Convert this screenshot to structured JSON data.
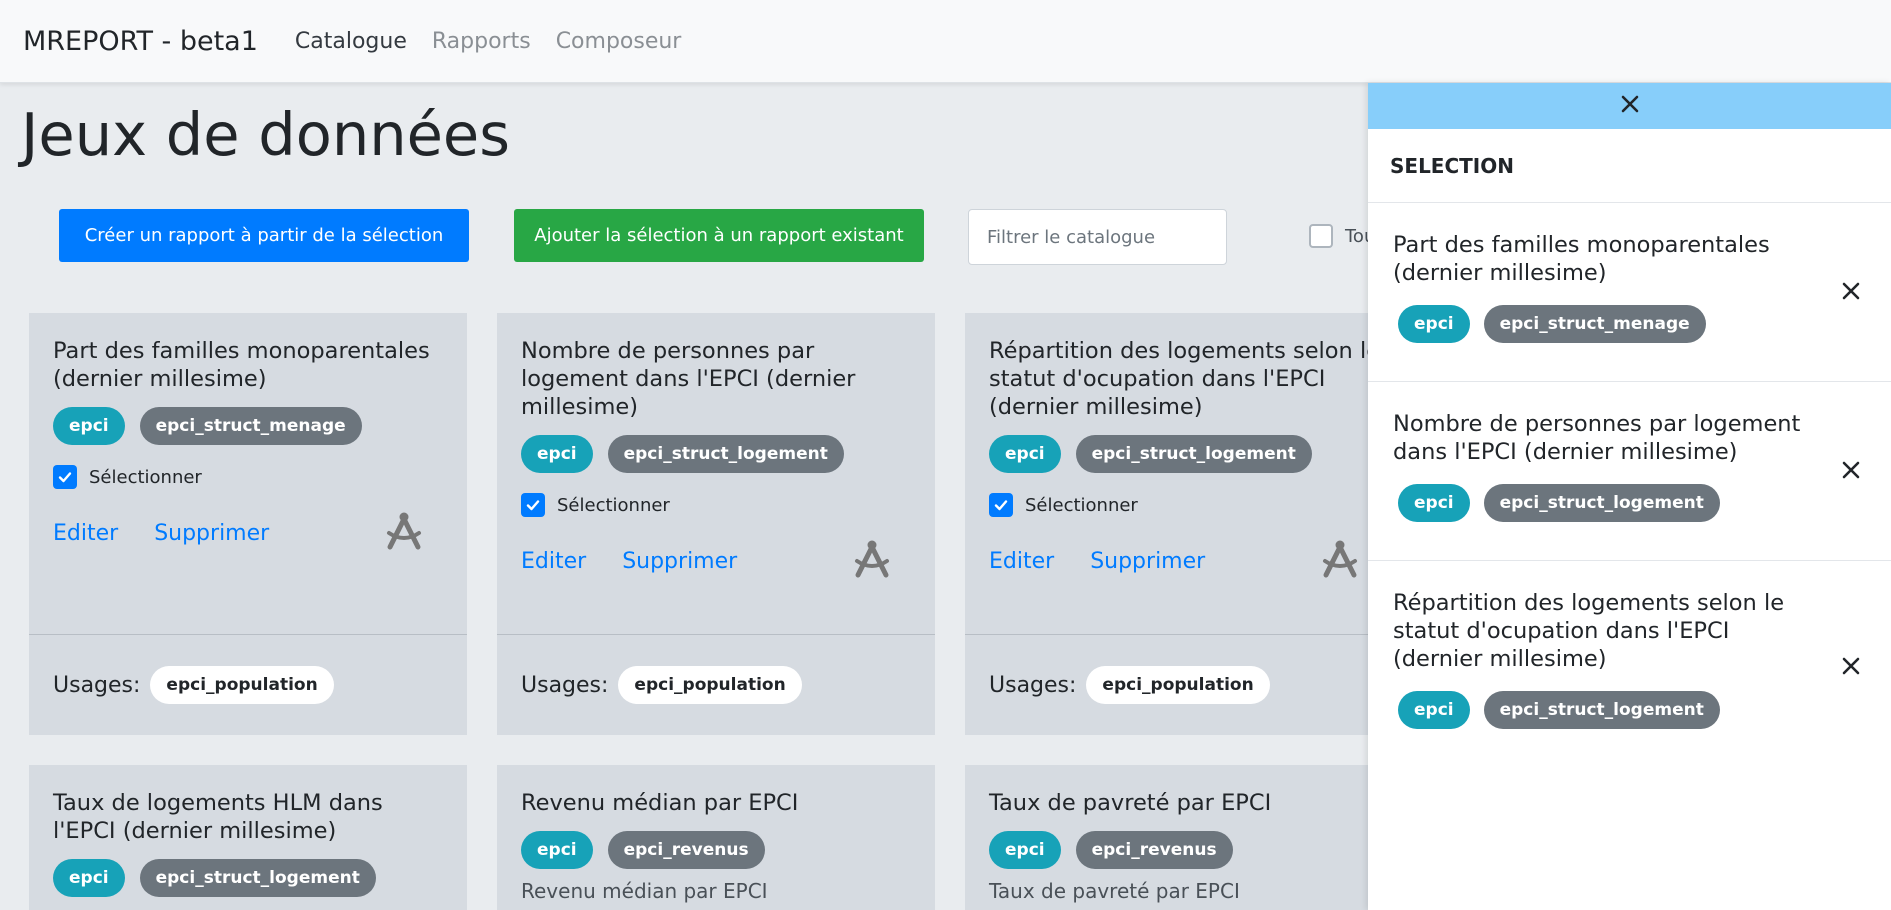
{
  "navbar": {
    "brand": "MREPORT - beta1",
    "links": [
      {
        "label": "Catalogue"
      },
      {
        "label": "Rapports"
      },
      {
        "label": "Composeur"
      }
    ]
  },
  "page": {
    "title": "Jeux de données"
  },
  "toolbar": {
    "create_label": "Créer un rapport à partir de la sélection",
    "add_label": "Ajouter la sélection à un rapport existant",
    "filter_placeholder": "Filtrer le catalogue",
    "toggle_all_label": "Tou"
  },
  "cards": [
    {
      "title": "Part des familles monoparentales (dernier millesime)",
      "badges": [
        "epci",
        "epci_struct_menage"
      ],
      "select_label": "Sélectionner",
      "edit_label": "Editer",
      "delete_label": "Supprimer",
      "usages_label": "Usages:",
      "usage": "epci_population"
    },
    {
      "title": "Nombre de personnes par logement dans l'EPCI (dernier millesime)",
      "badges": [
        "epci",
        "epci_struct_logement"
      ],
      "select_label": "Sélectionner",
      "edit_label": "Editer",
      "delete_label": "Supprimer",
      "usages_label": "Usages:",
      "usage": "epci_population"
    },
    {
      "title": "Répartition des logements selon le statut d'ocupation dans l'EPCI (dernier millesime)",
      "badges": [
        "epci",
        "epci_struct_logement"
      ],
      "select_label": "Sélectionner",
      "edit_label": "Editer",
      "delete_label": "Supprimer",
      "usages_label": "Usages:",
      "usage": "epci_population"
    },
    {
      "title": "Taux de logements HLM dans l'EPCI (dernier millesime)",
      "badges": [
        "epci",
        "epci_struct_logement"
      ]
    },
    {
      "title": "Revenu médian par EPCI",
      "badges": [
        "epci",
        "epci_revenus"
      ],
      "description": "Revenu médian par EPCI"
    },
    {
      "title": "Taux de pavreté par EPCI",
      "badges": [
        "epci",
        "epci_revenus"
      ],
      "description": "Taux de pavreté par EPCI"
    }
  ],
  "selection_panel": {
    "heading": "SELECTION",
    "items": [
      {
        "title": "Part des familles monoparentales (dernier millesime)",
        "badges": [
          "epci",
          "epci_struct_menage"
        ]
      },
      {
        "title": "Nombre de personnes par logement dans l'EPCI (dernier millesime)",
        "badges": [
          "epci",
          "epci_struct_logement"
        ]
      },
      {
        "title": "Répartition des logements selon le statut d'ocupation dans l'EPCI (dernier millesime)",
        "badges": [
          "epci",
          "epci_struct_logement"
        ]
      }
    ]
  },
  "colors": {
    "primary": "#007bff",
    "success": "#28a745",
    "info": "#17a2b8",
    "secondary": "#6c757d",
    "panel_header": "#87cefa"
  }
}
